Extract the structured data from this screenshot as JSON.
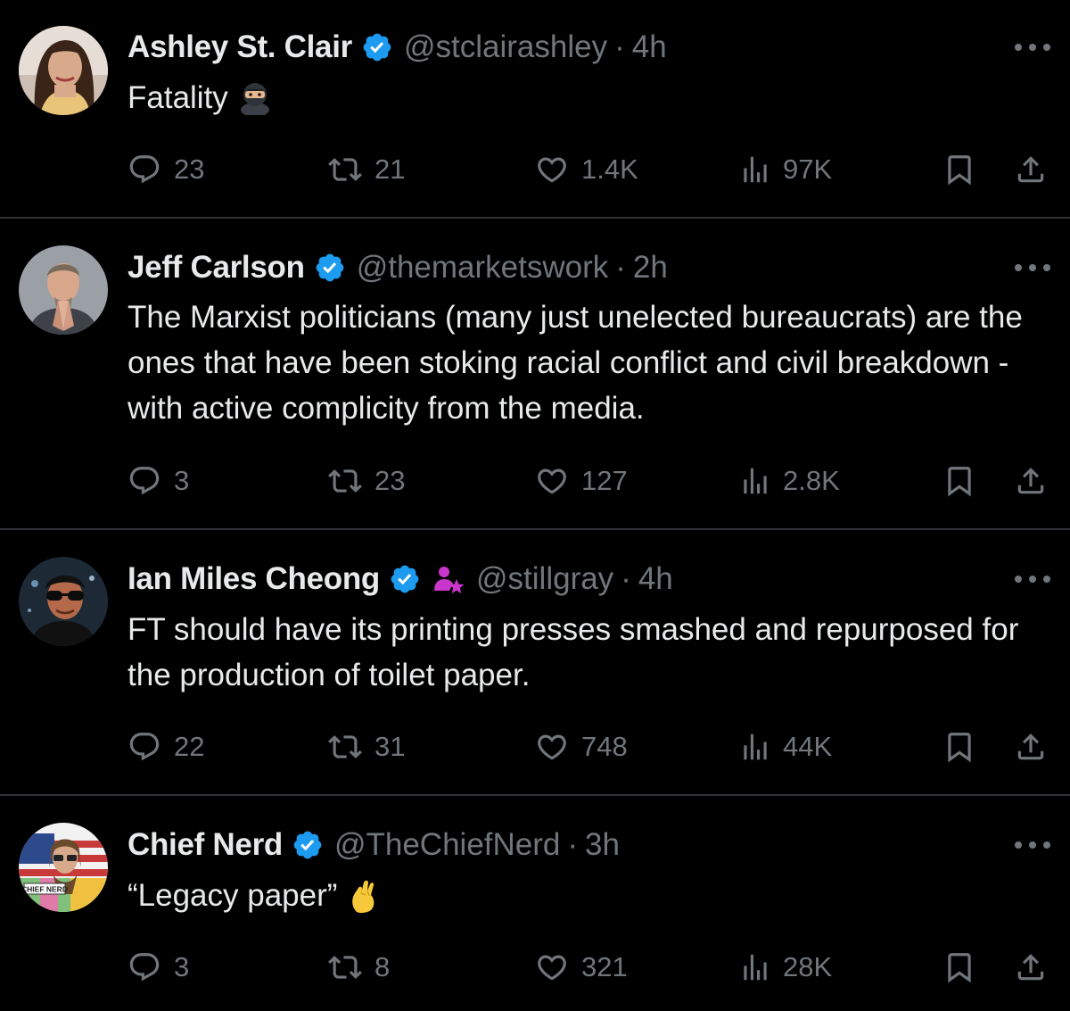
{
  "theme": {
    "background": "#000000",
    "text": "#e7e9ea",
    "muted": "#71767b",
    "divider": "#2f3336",
    "verified": "#1d9bf0",
    "affiliate": "#c936cc"
  },
  "tweets": [
    {
      "name": "Ashley St. Clair",
      "verified": true,
      "handle": "@stclairashley",
      "separator": "·",
      "time": "4h",
      "text": "Fatality",
      "emoji": "ninja-emoji",
      "avatar": "woman-portrait-avatar",
      "replies": "23",
      "retweets": "21",
      "likes": "1.4K",
      "views": "97K"
    },
    {
      "name": "Jeff Carlson",
      "verified": true,
      "handle": "@themarketswork",
      "separator": "·",
      "time": "2h",
      "text": "The Marxist politicians (many just unelected bureaucrats) are the ones that have been stoking racial conflict and civil breakdown - with active complicity from the media.",
      "avatar": "man-praying-avatar",
      "replies": "3",
      "retweets": "23",
      "likes": "127",
      "views": "2.8K"
    },
    {
      "name": "Ian Miles Cheong",
      "verified": true,
      "affiliate_icon": "person-star-icon",
      "handle": "@stillgray",
      "separator": "·",
      "time": "4h",
      "text": "FT should have its printing presses smashed and repurposed for the production of toilet paper.",
      "avatar": "man-sunglasses-avatar",
      "replies": "22",
      "retweets": "31",
      "likes": "748",
      "views": "44K"
    },
    {
      "name": "Chief Nerd",
      "verified": true,
      "handle": "@TheChiefNerd",
      "separator": "·",
      "time": "3h",
      "text": "“Legacy paper”",
      "emoji": "pinched-fingers-emoji",
      "avatar": "chief-nerd-logo-avatar",
      "avatar_logo_text": "CHIEF NERD",
      "replies": "3",
      "retweets": "8",
      "likes": "321",
      "views": "28K"
    }
  ]
}
